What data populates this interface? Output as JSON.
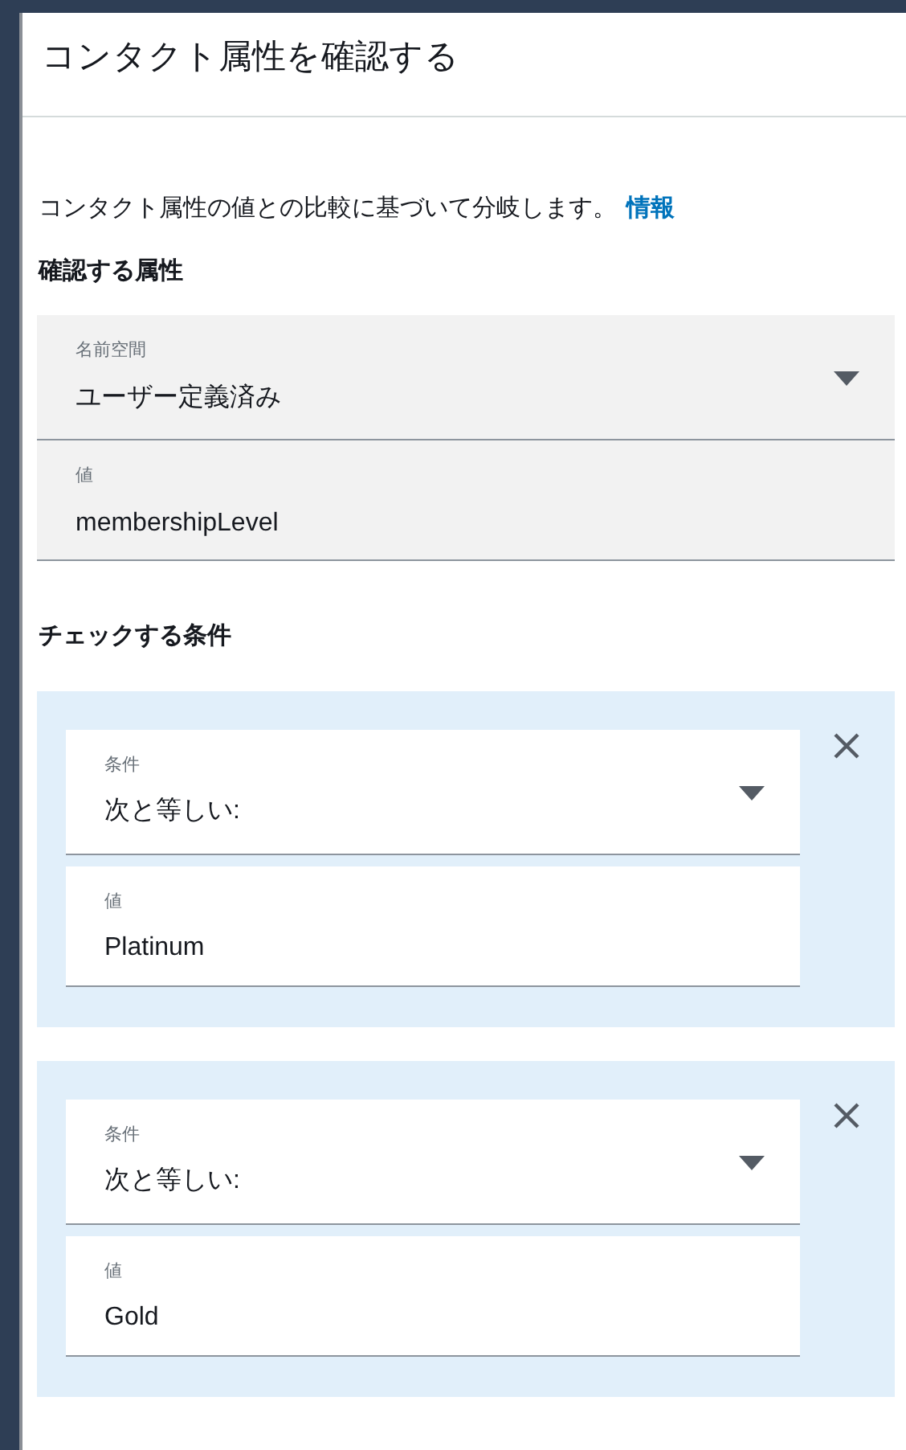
{
  "title": "コンタクト属性を確認する",
  "description": {
    "text": "コンタクト属性の値との比較に基づいて分岐します。",
    "link": "情報"
  },
  "attribute_heading": "確認する属性",
  "attribute_fields": [
    {
      "kind": "select",
      "label": "名前空間",
      "value": "ユーザー定義済み"
    },
    {
      "kind": "text",
      "label": "値",
      "value": "membershipLevel"
    }
  ],
  "conditions_heading": "チェックする条件",
  "conditions": [
    {
      "fields": [
        {
          "kind": "select",
          "label": "条件",
          "value": "次と等しい:"
        },
        {
          "kind": "text",
          "label": "値",
          "value": "Platinum"
        }
      ]
    },
    {
      "fields": [
        {
          "kind": "select",
          "label": "条件",
          "value": "次と等しい:"
        },
        {
          "kind": "text",
          "label": "値",
          "value": "Gold"
        }
      ]
    }
  ]
}
